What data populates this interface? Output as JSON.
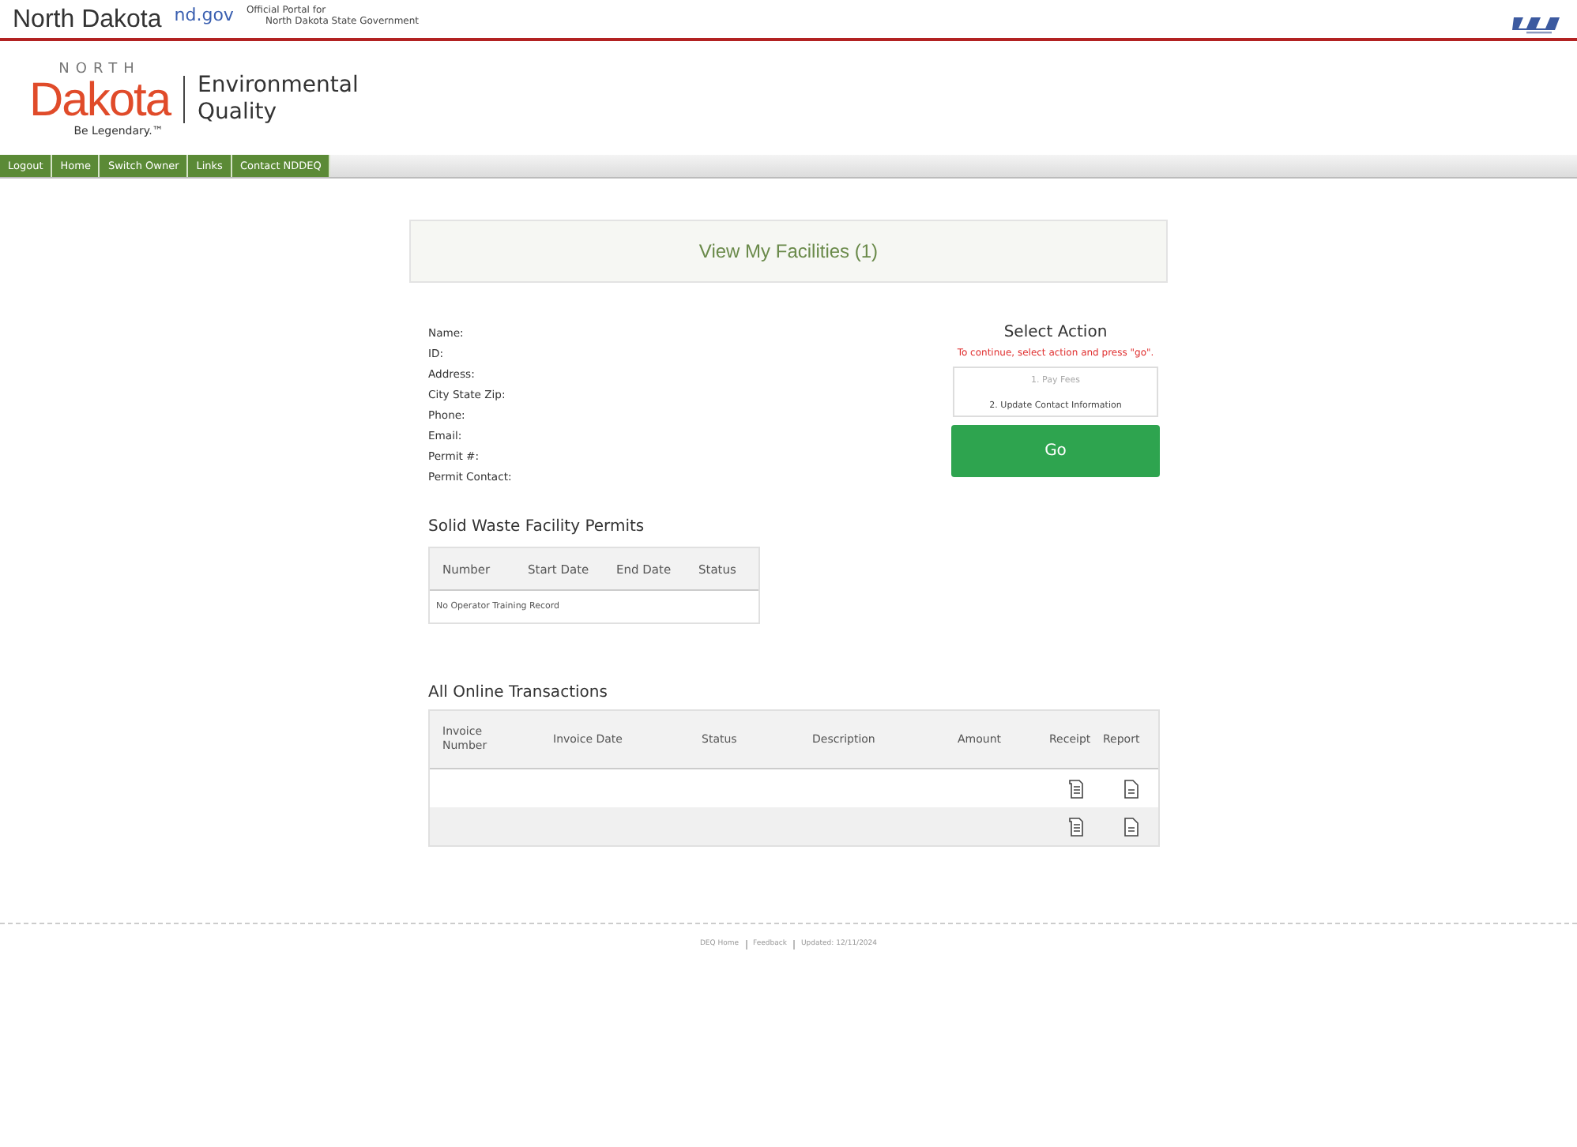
{
  "top_bar": {
    "state_name": "North Dakota",
    "portal_domain": "nd.gov",
    "portal_tagline": [
      "Official Portal for",
      "North Dakota State Government"
    ]
  },
  "agency_logo": {
    "top": "NORTH",
    "main": "Dakota",
    "slogan": "Be Legendary.™",
    "agency": [
      "Environmental",
      "Quality"
    ]
  },
  "nav": [
    {
      "label": "Logout"
    },
    {
      "label": "Home"
    },
    {
      "label": "Switch Owner"
    },
    {
      "label": "Links"
    },
    {
      "label": "Contact NDDEQ"
    }
  ],
  "page_title": "View My Facilities (1)",
  "facility_fields": [
    "Name:",
    "ID:",
    "Address:",
    "City State Zip:",
    "Phone:",
    "Email:",
    "Permit #:",
    "Permit Contact:"
  ],
  "select_action": {
    "title": "Select Action",
    "hint": "To continue, select action and press \"go\".",
    "options": [
      {
        "label": "1. Pay Fees",
        "disabled": true
      },
      {
        "label": "2. Update Contact Information",
        "disabled": false
      }
    ],
    "button": "Go"
  },
  "permits": {
    "title": "Solid Waste Facility Permits",
    "columns": [
      "Number",
      "Start Date",
      "End Date",
      "Status"
    ],
    "empty_message": "No Operator Training Record"
  },
  "transactions": {
    "title": "All Online Transactions",
    "columns": [
      "Invoice Number",
      "Invoice Date",
      "Status",
      "Description",
      "Amount",
      "Receipt",
      "Report"
    ],
    "rows": [
      {
        "receipt": true,
        "report": true
      },
      {
        "receipt": true,
        "report": true
      }
    ]
  },
  "footer": {
    "links": [
      "DEQ Home",
      "Feedback"
    ],
    "updated": "Updated: 12/11/2024"
  }
}
